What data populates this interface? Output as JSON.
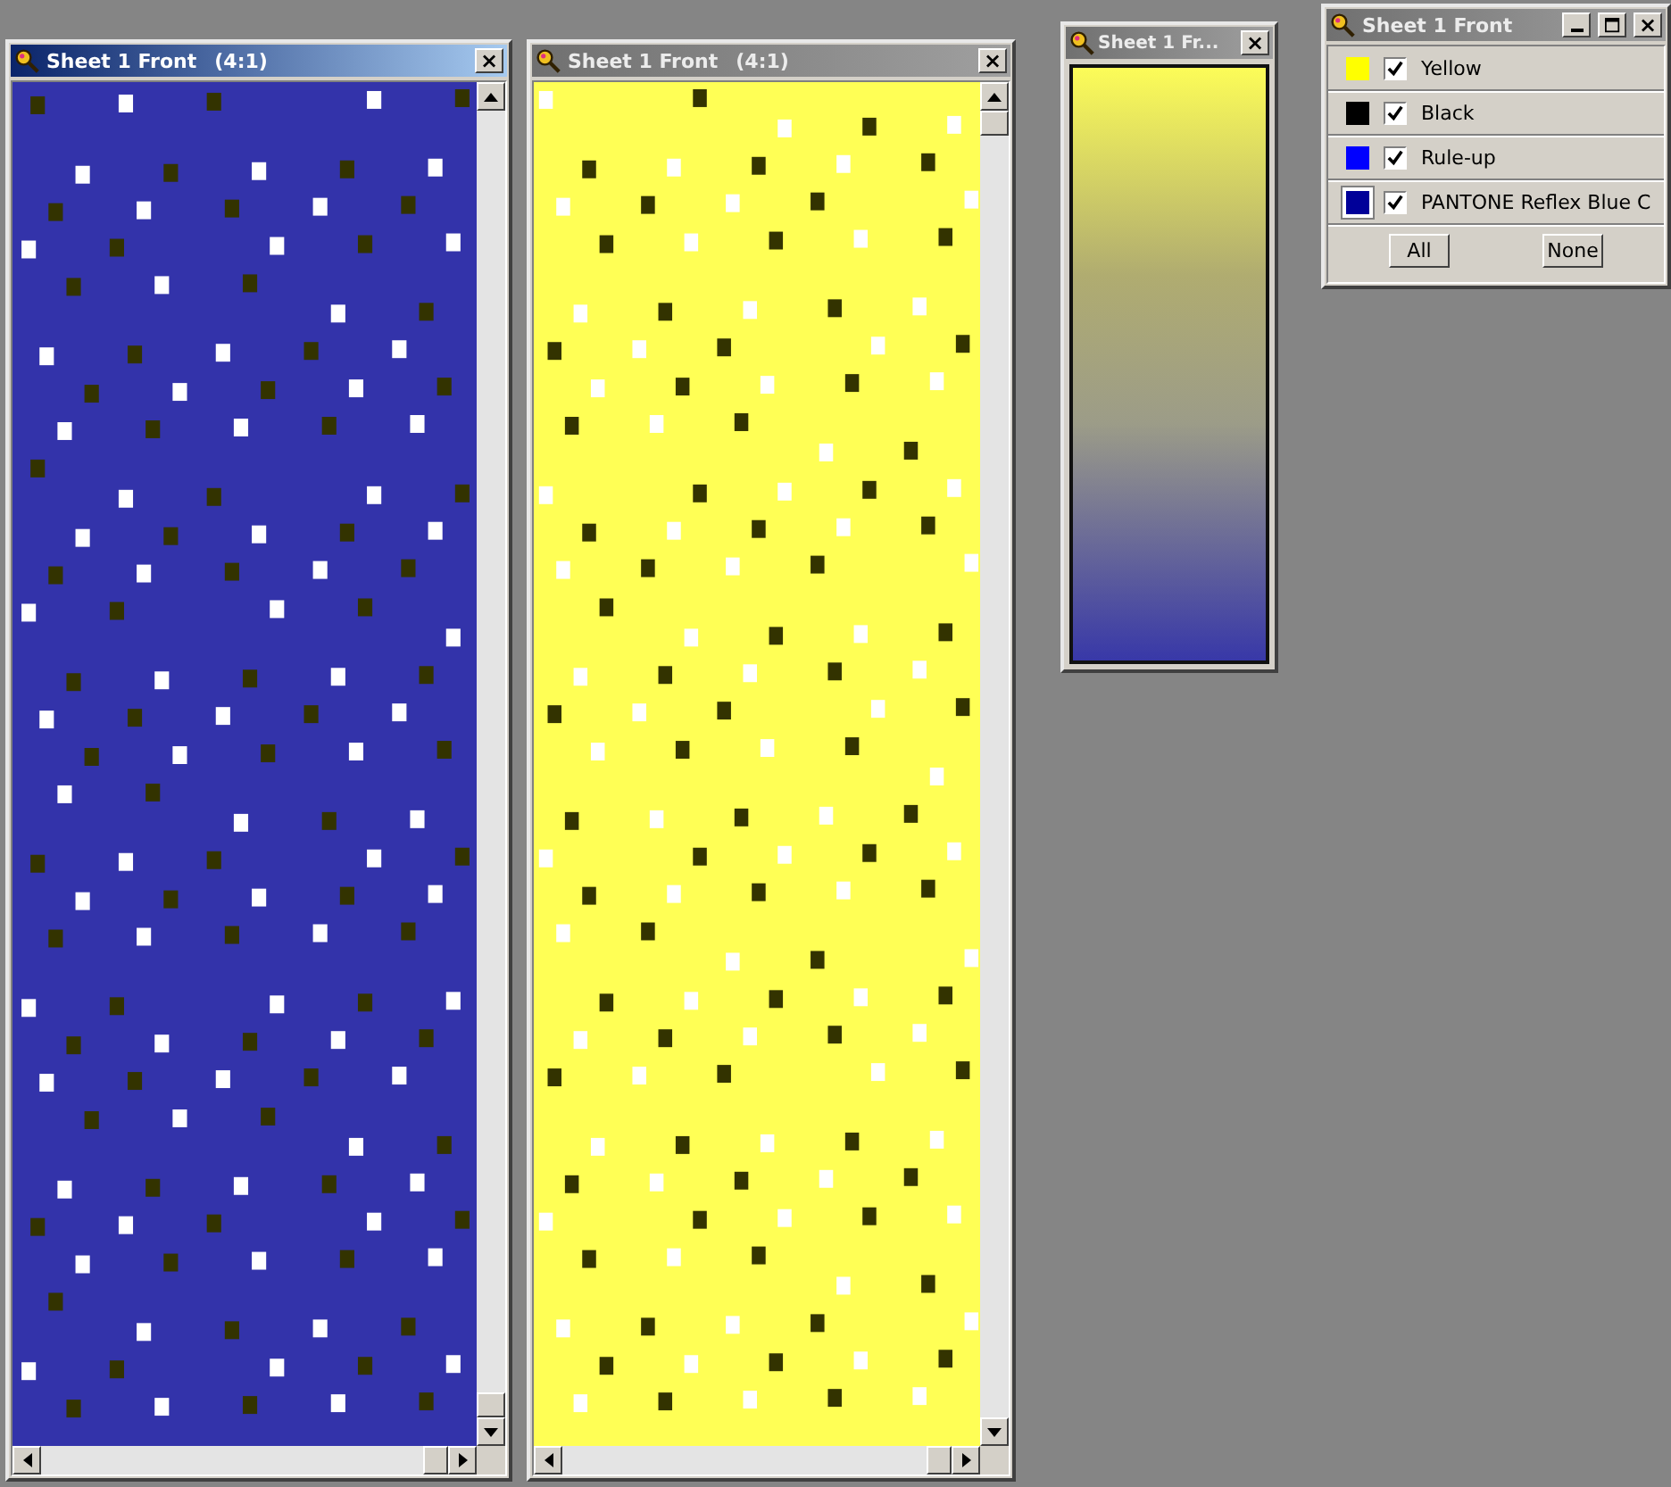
{
  "windows": [
    {
      "kind": "document",
      "title": "Sheet 1 Front",
      "zoom": "(4:1)",
      "active": true,
      "color": "#3333aa",
      "close": "×"
    },
    {
      "kind": "document",
      "title": "Sheet 1 Front",
      "zoom": "(4:1)",
      "active": false,
      "color": "#ffff55",
      "close": "×"
    },
    {
      "kind": "preview",
      "title": "Sheet 1 Fr...",
      "active": false,
      "close": "×"
    },
    {
      "kind": "separations",
      "title": "Sheet 1 Front",
      "active": false,
      "close": "×",
      "separations": [
        {
          "name": "Yellow",
          "color": "#ffff00",
          "checked": true,
          "selected": false
        },
        {
          "name": "Black",
          "color": "#000000",
          "checked": true,
          "selected": false
        },
        {
          "name": "Rule-up",
          "color": "#0000ff",
          "checked": true,
          "selected": false
        },
        {
          "name": "PANTONE Reflex Blue C",
          "color": "#000099",
          "checked": true,
          "selected": true
        }
      ],
      "buttons": [
        "All",
        "None"
      ]
    }
  ]
}
